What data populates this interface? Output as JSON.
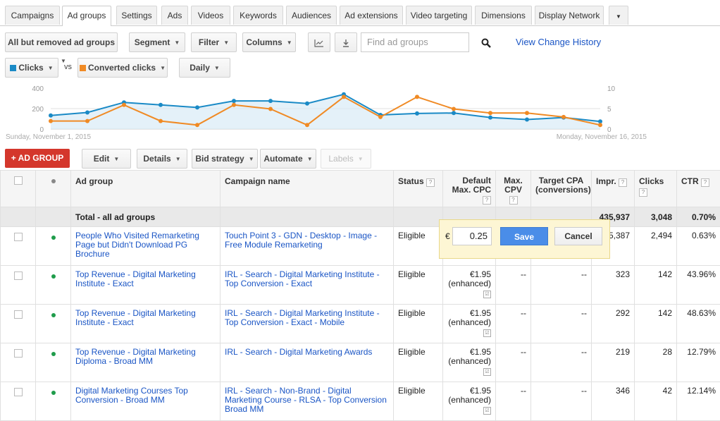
{
  "tabs": [
    {
      "label": "Campaigns"
    },
    {
      "label": "Ad groups",
      "active": true
    },
    {
      "label": "Settings"
    },
    {
      "label": "Ads"
    },
    {
      "label": "Videos"
    },
    {
      "label": "Keywords"
    },
    {
      "label": "Audiences"
    },
    {
      "label": "Ad extensions"
    },
    {
      "label": "Video targeting"
    },
    {
      "label": "Dimensions"
    },
    {
      "label": "Display Network"
    }
  ],
  "toolbar": {
    "filter_view": "All but removed ad groups",
    "segment": "Segment",
    "filter": "Filter",
    "columns": "Columns",
    "search_placeholder": "Find ad groups",
    "change_history": "View Change History"
  },
  "metrics": {
    "metric1": "Clicks",
    "vs": "vs",
    "metric2": "Converted clicks",
    "period": "Daily",
    "colors": {
      "clicks": "#1a8ac6",
      "converted": "#f08a24"
    }
  },
  "chart_data": {
    "type": "line",
    "x": [
      "2015-11-01",
      "2015-11-02",
      "2015-11-03",
      "2015-11-04",
      "2015-11-05",
      "2015-11-06",
      "2015-11-07",
      "2015-11-08",
      "2015-11-09",
      "2015-11-10",
      "2015-11-11",
      "2015-11-12",
      "2015-11-13",
      "2015-11-14",
      "2015-11-15",
      "2015-11-16"
    ],
    "x_start_label": "Sunday, November 1, 2015",
    "x_end_label": "Monday, November 16, 2015",
    "yticks_left": [
      "400",
      "200",
      "0"
    ],
    "yticks_right": [
      "10",
      "5",
      "0"
    ],
    "ylim_left": [
      0,
      400
    ],
    "ylim_right": [
      0,
      10
    ],
    "series": [
      {
        "name": "Clicks",
        "axis": "left",
        "color": "#1a8ac6",
        "values": [
          135,
          165,
          265,
          240,
          215,
          280,
          280,
          255,
          345,
          140,
          155,
          160,
          115,
          95,
          115,
          75
        ]
      },
      {
        "name": "Converted clicks",
        "axis": "right",
        "color": "#f08a24",
        "values": [
          2,
          2,
          6,
          2,
          1,
          6,
          5,
          1,
          8,
          3,
          8,
          5,
          4,
          4,
          3,
          1
        ]
      }
    ]
  },
  "actions": {
    "add": "+ AD GROUP",
    "edit": "Edit",
    "details": "Details",
    "bid_strategy": "Bid strategy",
    "automate": "Automate",
    "labels": "Labels"
  },
  "table": {
    "headers": {
      "ad_group": "Ad group",
      "campaign": "Campaign name",
      "status": "Status",
      "default_cpc_1": "Default",
      "default_cpc_2": "Max. CPC",
      "cpv_1": "Max.",
      "cpv_2": "CPV",
      "tcpa_1": "Target CPA",
      "tcpa_2": "(conversions)",
      "impr": "Impr.",
      "clicks": "Clicks",
      "ctr": "CTR",
      "help": "?"
    },
    "total": {
      "label": "Total - all ad groups",
      "impr": "435,937",
      "clicks": "3,048",
      "ctr": "0.70%"
    },
    "rows": [
      {
        "ad_group": "People Who Visited Remarketing Page but Didn't Download PG Brochure",
        "campaign": "Touch Point 3 - GDN - Desktop - Image - Free Module Remarketing",
        "status": "Eligible",
        "cpc": "",
        "cpc_note": "",
        "cpv": "",
        "tcpa": "",
        "impr": "5,387",
        "clicks": "2,494",
        "ctr": "0.63%"
      },
      {
        "ad_group": "Top Revenue - Digital Marketing Institute - Exact",
        "campaign": "IRL - Search - Digital Marketing Institute - Top Conversion - Exact",
        "status": "Eligible",
        "cpc": "€1.95",
        "cpc_note": "(enhanced)",
        "cpv": "--",
        "tcpa": "--",
        "impr": "323",
        "clicks": "142",
        "ctr": "43.96%"
      },
      {
        "ad_group": "Top Revenue - Digital Marketing Institute - Exact",
        "campaign": "IRL - Search - Digital Marketing Institute - Top Conversion - Exact - Mobile",
        "status": "Eligible",
        "cpc": "€1.95",
        "cpc_note": "(enhanced)",
        "cpv": "--",
        "tcpa": "--",
        "impr": "292",
        "clicks": "142",
        "ctr": "48.63%"
      },
      {
        "ad_group": "Top Revenue - Digital Marketing Diploma - Broad MM",
        "campaign": "IRL - Search - Digital Marketing Awards",
        "status": "Eligible",
        "cpc": "€1.95",
        "cpc_note": "(enhanced)",
        "cpv": "--",
        "tcpa": "--",
        "impr": "219",
        "clicks": "28",
        "ctr": "12.79%"
      },
      {
        "ad_group": "Digital Marketing Courses Top Conversion - Broad MM",
        "campaign": "IRL - Search - Non-Brand - Digital Marketing Course - RLSA - Top Conversion Broad MM",
        "status": "Eligible",
        "cpc": "€1.95",
        "cpc_note": "(enhanced)",
        "cpv": "--",
        "tcpa": "--",
        "impr": "346",
        "clicks": "42",
        "ctr": "12.14%"
      }
    ]
  },
  "inline_edit": {
    "currency": "€",
    "value": "0.25",
    "save": "Save",
    "cancel": "Cancel"
  },
  "colors": {
    "link": "#1a55c5",
    "status_dot": "#1f9c4b",
    "add_button": "#d4372c",
    "save_button": "#4a8de8"
  }
}
